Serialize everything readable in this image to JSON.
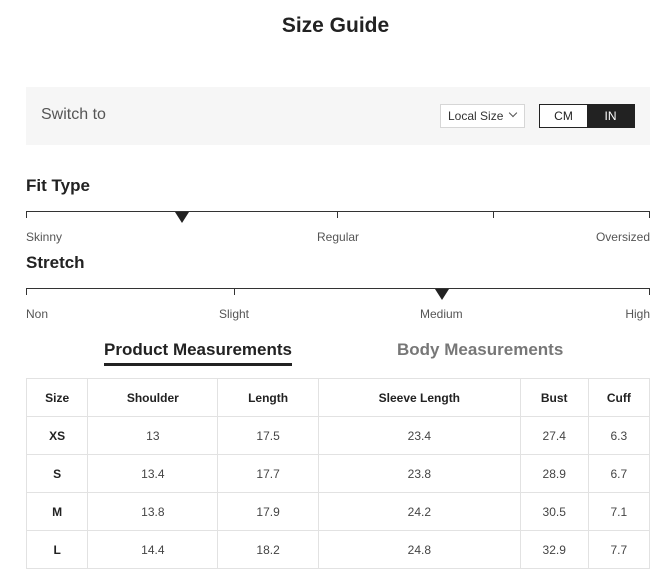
{
  "title": "Size Guide",
  "switch": {
    "label": "Switch to",
    "select_value": "Local Size",
    "units": [
      {
        "label": "CM",
        "active": false
      },
      {
        "label": "IN",
        "active": true
      }
    ]
  },
  "fit_type": {
    "title": "Fit Type",
    "labels": [
      "Skinny",
      "Regular",
      "Oversized"
    ],
    "selected_fraction": 0.25
  },
  "stretch": {
    "title": "Stretch",
    "labels": [
      "Non",
      "Slight",
      "Medium",
      "High"
    ],
    "selected_fraction": 0.667
  },
  "tabs": {
    "product": "Product Measurements",
    "body": "Body Measurements"
  },
  "table": {
    "headers": [
      "Size",
      "Shoulder",
      "Length",
      "Sleeve Length",
      "Bust",
      "Cuff"
    ],
    "rows": [
      [
        "XS",
        "13",
        "17.5",
        "23.4",
        "27.4",
        "6.3"
      ],
      [
        "S",
        "13.4",
        "17.7",
        "23.8",
        "28.9",
        "6.7"
      ],
      [
        "M",
        "13.8",
        "17.9",
        "24.2",
        "30.5",
        "7.1"
      ],
      [
        "L",
        "14.4",
        "18.2",
        "24.8",
        "32.9",
        "7.7"
      ]
    ]
  },
  "colors": {
    "accent": "#222222",
    "bar_background": "#f6f6f6"
  }
}
